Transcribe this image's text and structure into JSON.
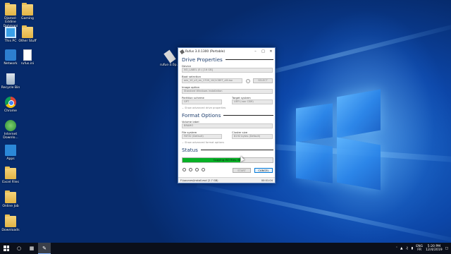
{
  "desktop": {
    "icons": [
      {
        "label": "Djamel-Eddine Dahmani",
        "icon": "user-folder-icon"
      },
      {
        "label": "Gaming",
        "icon": "folder-icon"
      },
      {
        "label": "This PC",
        "icon": "computer-icon"
      },
      {
        "label": "Other Stuff",
        "icon": "folder-icon"
      },
      {
        "label": "Network",
        "icon": "network-icon"
      },
      {
        "label": "rufus.ini",
        "icon": "ini-file-icon"
      },
      {
        "label": "Recycle Bin",
        "icon": "recycle-bin-icon"
      },
      {
        "label": "Chrome",
        "icon": "chrome-icon"
      },
      {
        "label": "Internet Downlo...",
        "icon": "internet-download-manager-icon"
      },
      {
        "label": "Apps",
        "icon": "apps-folder-icon"
      },
      {
        "label": "Excel Files",
        "icon": "folder-icon"
      },
      {
        "label": "Online Job",
        "icon": "folder-icon"
      },
      {
        "label": "Downloads",
        "icon": "folder-icon"
      },
      {
        "label": "rufus-3.0p...",
        "icon": "usb-drive-icon"
      }
    ]
  },
  "rufus": {
    "title": "Rufus 3.0.1300 (Portable)",
    "drive_properties": {
      "heading": "Drive Properties",
      "device_label": "Device",
      "device_value": "NO_LABEL (E:) [16 GB]",
      "boot_selection_label": "Boot selection",
      "boot_selection_value": "win_10_x3_en_1709_10(1CB5T_dlll.iso",
      "select_label": "SELECT",
      "image_option_label": "Image option",
      "image_option_value": "Standard Windows installation",
      "partition_scheme_label": "Partition scheme",
      "partition_scheme_value": "GPT",
      "target_system_label": "Target system",
      "target_system_value": "UEFI (non CSM)",
      "advanced_label": "Show advanced drive properties"
    },
    "format_options": {
      "heading": "Format Options",
      "volume_label_label": "Volume label",
      "volume_label_value": "BRAMO",
      "file_system_label": "File system",
      "file_system_value": "FAT32 (Default)",
      "cluster_size_label": "Cluster size",
      "cluster_size_value": "8192 bytes (Default)",
      "advanced_label": "Show advanced format options"
    },
    "status": {
      "heading": "Status",
      "progress_text": "Copying ISO files: 60.",
      "progress_fraction": 0.64
    },
    "buttons": {
      "start": "START",
      "cancel": "CANCEL"
    },
    "statusbar": {
      "left": "F:\\sources\\install.esd (2.7 GB)",
      "right": "00:01:04"
    }
  },
  "taskbar": {
    "language_line1": "ENG",
    "language_line2": "FR",
    "time": "5:20 PM",
    "date": "12/4/2019"
  }
}
